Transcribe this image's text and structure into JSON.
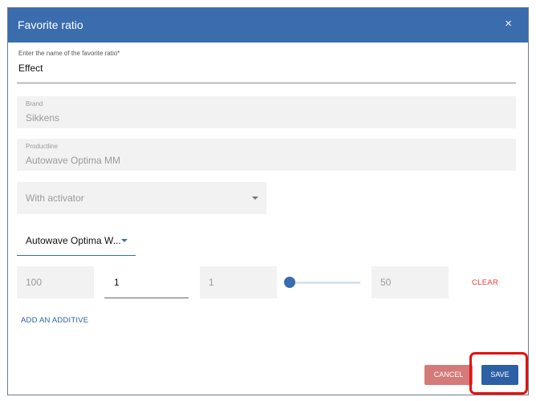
{
  "dialog": {
    "title": "Favorite ratio",
    "close_glyph": "×"
  },
  "form": {
    "name_label": "Enter the name of the favorite ratio*",
    "name_value": "Effect",
    "brand_label": "Brand",
    "brand_value": "Sikkens",
    "productline_label": "Productline",
    "productline_value": "Autowave Optima MM",
    "activator_value": "With activator",
    "product_value": "Autowave Optima W...",
    "ratio_fields": [
      "100",
      "1",
      "1",
      "50"
    ],
    "slider_level_fraction": 0.0,
    "clear_label": "CLEAR",
    "add_additive_label": "ADD AN ADDITIVE"
  },
  "actions": {
    "cancel_label": "CANCEL",
    "save_label": "SAVE"
  },
  "colors": {
    "header_bg": "#3a6cae",
    "primary": "#2c5fa3",
    "cancel": "#d47a79",
    "clear": "#e23b3b",
    "highlight": "#e31010"
  }
}
